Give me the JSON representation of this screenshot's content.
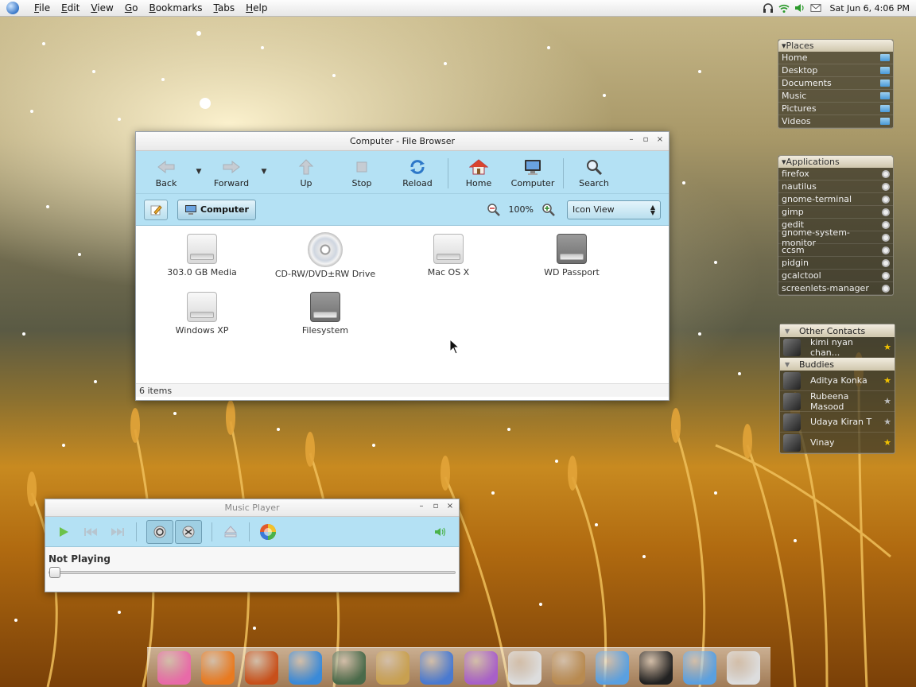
{
  "menubar": {
    "items": [
      "File",
      "Edit",
      "View",
      "Go",
      "Bookmarks",
      "Tabs",
      "Help"
    ],
    "clock": "Sat Jun  6,  4:06 PM",
    "tray_icons": [
      "headphones-icon",
      "wifi-icon",
      "volume-icon",
      "mail-icon"
    ]
  },
  "file_browser": {
    "title": "Computer - File Browser",
    "toolbar": {
      "back": "Back",
      "forward": "Forward",
      "up": "Up",
      "stop": "Stop",
      "reload": "Reload",
      "home": "Home",
      "computer": "Computer",
      "search": "Search"
    },
    "location": "Computer",
    "zoom": "100%",
    "view_mode": "Icon View",
    "items": [
      {
        "label": "303.0 GB Media",
        "kind": "drive"
      },
      {
        "label": "CD-RW/DVD±RW Drive",
        "kind": "disc"
      },
      {
        "label": "Mac OS X",
        "kind": "drive"
      },
      {
        "label": "WD Passport",
        "kind": "hd"
      },
      {
        "label": "Windows XP",
        "kind": "drive"
      },
      {
        "label": "Filesystem",
        "kind": "hd"
      }
    ],
    "status": "6 items"
  },
  "music_player": {
    "title": "Music Player",
    "now_playing": "Not Playing",
    "progress": 0
  },
  "places": {
    "header": "▾Places",
    "items": [
      "Home",
      "Desktop",
      "Documents",
      "Music",
      "Pictures",
      "Videos"
    ]
  },
  "applications": {
    "header": "▾Applications",
    "items": [
      "firefox",
      "nautilus",
      "gnome-terminal",
      "gimp",
      "gedit",
      "gnome-system-monitor",
      "ccsm",
      "pidgin",
      "gcalctool",
      "screenlets-manager"
    ]
  },
  "contacts": {
    "other_header": "Other Contacts",
    "other": [
      {
        "name": "kimi nyan chan...",
        "star_color": "#f2c200"
      }
    ],
    "buddies_header": "Buddies",
    "buddies": [
      {
        "name": "Aditya Konka",
        "star_color": "#f2c200"
      },
      {
        "name": "Rubeena Masood",
        "star_color": "#bbbbbb"
      },
      {
        "name": "Udaya Kiran T",
        "star_color": "#bbbbbb"
      },
      {
        "name": "Vinay",
        "star_color": "#f2c200"
      }
    ]
  },
  "dock": {
    "icons": [
      "pink-swirl-icon",
      "firefox-icon",
      "ubuntu-orb-icon",
      "mushroom-icon",
      "photos-icon",
      "notebook-icon",
      "image-editor-icon",
      "paint-icon",
      "calendar-icon",
      "package-icon",
      "folder-icon",
      "camera-lens-icon",
      "folder-icon",
      "headphones-icon"
    ]
  }
}
